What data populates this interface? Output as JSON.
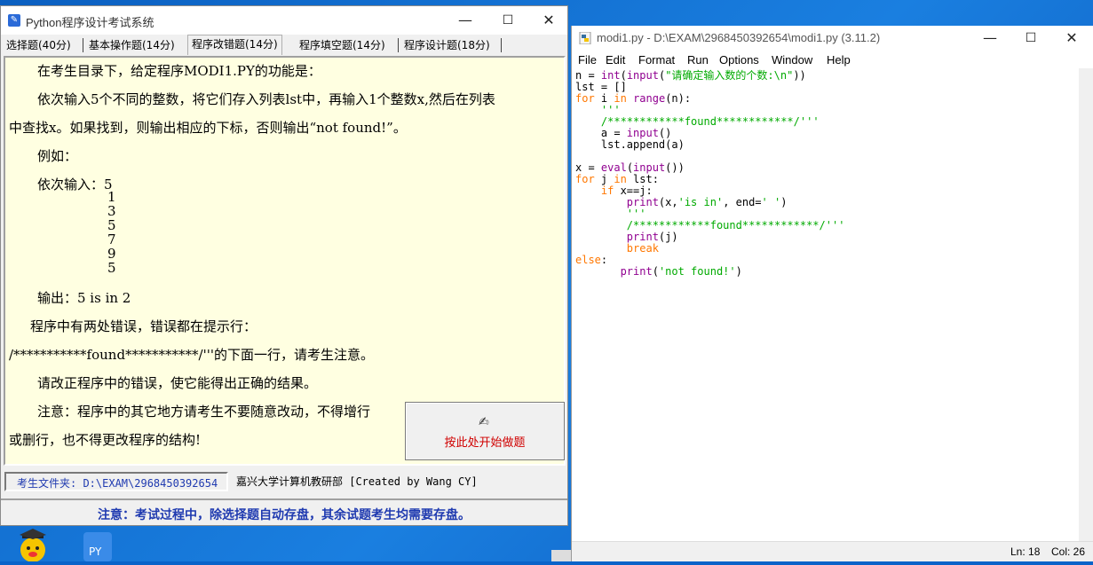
{
  "exam": {
    "title": "Python程序设计考试系统",
    "tabs": [
      "选择题(40分)",
      "基本操作题(14分)",
      "程序改错题(14分)",
      "程序填空题(14分)",
      "程序设计题(18分)"
    ],
    "active_tab": 2,
    "question_lines": [
      "在考生目录下，给定程序MODI1.PY的功能是：",
      "依次输入5个不同的整数，将它们存入列表lst中，再输入1个整数x,然后在列表",
      "中查找x。如果找到，则输出相应的下标，否则输出“not found!”。",
      "例如：",
      "依次输入：5",
      "1",
      "3",
      "5",
      "7",
      "9",
      "5",
      "输出：5 is in 2",
      "程序中有两处错误，错误都在提示行：",
      "/***********found***********/'''的下面一行，请考生注意。",
      "请改正程序中的错误，使它能得出正确的结果。",
      "注意：程序中的其它地方请考生不要随意改动，不得增行",
      "或删行，也不得更改程序的结构!"
    ],
    "start_button": "按此处开始做题",
    "exam_dir": "考生文件夹: D:\\EXAM\\2968450392654",
    "credit": "嘉兴大学计算机教研部 [Created by Wang CY]",
    "notice": "注意：考试过程中，除选择题自动存盘，其余试题考生均需要存盘。"
  },
  "idle": {
    "title": "modi1.py - D:\\EXAM\\2968450392654\\modi1.py (3.11.2)",
    "menus": [
      "File",
      "Edit",
      "Format",
      "Run",
      "Options",
      "Window",
      "Help"
    ],
    "status_line": "Ln: 18",
    "status_col": "Col: 26"
  },
  "colors": {
    "panel_bg": "#ffffe1",
    "notice_text": "#1f3ab0",
    "start_text": "#d00000",
    "keyword": "#ff7700",
    "builtin": "#900090",
    "string": "#00aa00"
  }
}
